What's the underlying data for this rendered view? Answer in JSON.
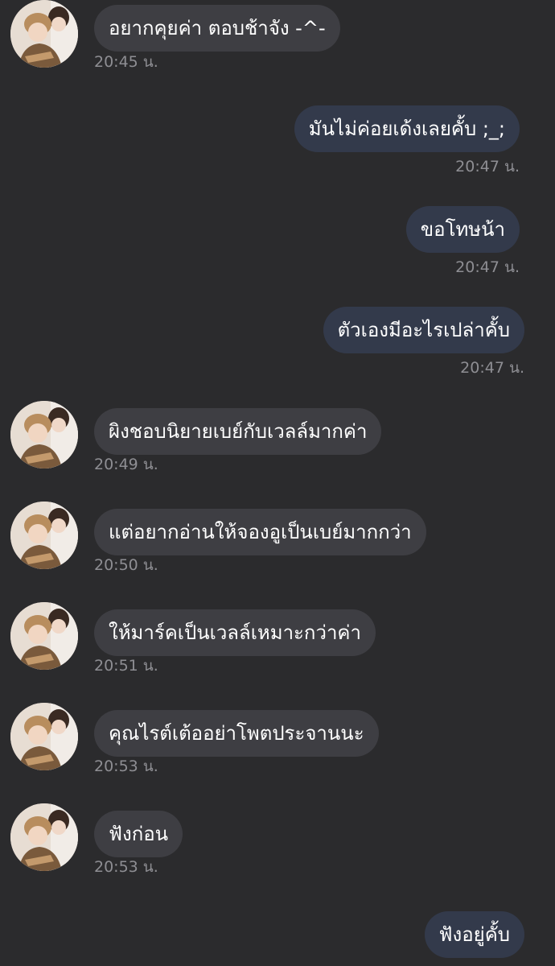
{
  "messages": [
    {
      "side": "in",
      "text": "อยากคุยค่า ตอบช้าจัง -^-",
      "time": "20:45 น."
    },
    {
      "side": "out",
      "text": "มันไม่ค่อยเด้งเลยคั้บ ;_;",
      "time": "20:47 น."
    },
    {
      "side": "out",
      "text": "ขอโทษน้า",
      "time": "20:47 น."
    },
    {
      "side": "out",
      "text": "ตัวเองมีอะไรเปล่าคั้บ",
      "time": "20:47 น."
    },
    {
      "side": "in",
      "text": "ผิงชอบนิยายเบย์กับเวลล์มากค่า",
      "time": "20:49 น."
    },
    {
      "side": "in",
      "text": "แต่อยากอ่านให้จองอูเป็นเบย์มากกว่า",
      "time": "20:50 น."
    },
    {
      "side": "in",
      "text": "ให้มาร์คเป็นเวลล์เหมาะกว่าค่า",
      "time": "20:51 น."
    },
    {
      "side": "in",
      "text": "คุณไรต์เต้ออย่าโพตประจานนะ",
      "time": "20:53 น."
    },
    {
      "side": "in",
      "text": "ฟังก่อน",
      "time": "20:53 น."
    },
    {
      "side": "out",
      "text": "ฟังอยู่คั้บ",
      "time": ""
    }
  ],
  "colors": {
    "background": "#2b2b2d",
    "incoming_bubble": "#3e3e43",
    "outgoing_bubble": "#333a4b",
    "timestamp": "#8e8e93",
    "text": "#ffffff"
  },
  "icons": {
    "avatar": "contact-avatar-photo"
  }
}
